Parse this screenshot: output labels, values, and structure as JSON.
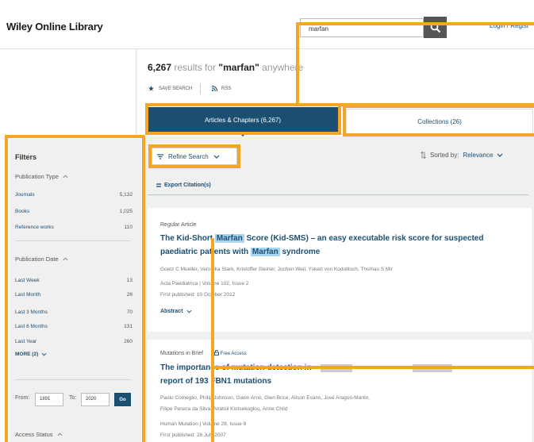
{
  "header": {
    "site_title": "Wiley Online Library",
    "search_value": "marfan",
    "login_label": "Login / Regist"
  },
  "results": {
    "count": "6,267",
    "text_mid": "results for",
    "query": "\"marfan\"",
    "text_end": "anywhere",
    "save_search_label": "SAVE SEARCH",
    "rss_label": "RSS"
  },
  "tabs": {
    "articles": "Articles & Chapters (6,267)",
    "collections": "Collections (26)"
  },
  "toolbar": {
    "refine_label": "Refine Search",
    "sort_prefix": "Sorted by:",
    "sort_value": "Relevance",
    "export_label": "Export Citation(s)"
  },
  "articles": [
    {
      "kind": "Regular Article",
      "title_parts": [
        "The Kid-Short ",
        "Marfan",
        " Score (Kid-SMS) – an easy executable risk score for suspected",
        "paediatric patients with ",
        "Marfan",
        " syndrome"
      ],
      "authors": "Goetz C Mueller, Veronika Stark, Kristoffer Steiner, Jochen Weil, Yskert von Kodolitsch, Thomas S Mir",
      "journal": "Acta Paediatrica | Volume 102, Issue 2",
      "published": "First published: 10 October 2012",
      "abstract_label": "Abstract"
    },
    {
      "kind": "Mutations in Brief",
      "free_label": "Free Access",
      "title_line1": "The importance of mutation detection in",
      "title_line2": "report of 193 FBN1 mutations",
      "authors_line1": "Paolo Comeglio, Philip Johnson, Gavin Arno, Glen Brice, Alison Evans, José Aragon-Martin,",
      "authors_line2": "Filipe Pereira da Silva, Anatoli Kiotsekoglou, Anne Child",
      "journal": "Human Mutation | Volume 28, Issue 9",
      "published": "First published: 26 July 2007"
    }
  ],
  "filters": {
    "title": "Filters",
    "publication_type": {
      "heading": "Publication Type",
      "items": [
        {
          "label": "Journals",
          "count": "5,132"
        },
        {
          "label": "Books",
          "count": "1,025"
        },
        {
          "label": "Reference works",
          "count": "110"
        }
      ]
    },
    "publication_date": {
      "heading": "Publication Date",
      "items": [
        {
          "label": "Last Week",
          "count": "13"
        },
        {
          "label": "Last Month",
          "count": "26"
        },
        {
          "label": "Last 3 Months",
          "count": "70"
        },
        {
          "label": "Last 6 Months",
          "count": "131"
        },
        {
          "label": "Last Year",
          "count": "260"
        }
      ],
      "more_label": "MORE (2)"
    },
    "year_range": {
      "from_label": "From:",
      "from_value": "1891",
      "to_label": "To:",
      "to_value": "2020",
      "go_label": "Go"
    },
    "access_status_heading": "Access Status"
  },
  "colors": {
    "brand_navy": "#1b4f71",
    "link_blue": "#1d4f72",
    "highlight": "#a9d3ee",
    "annotation_orange": "#f2a623"
  }
}
